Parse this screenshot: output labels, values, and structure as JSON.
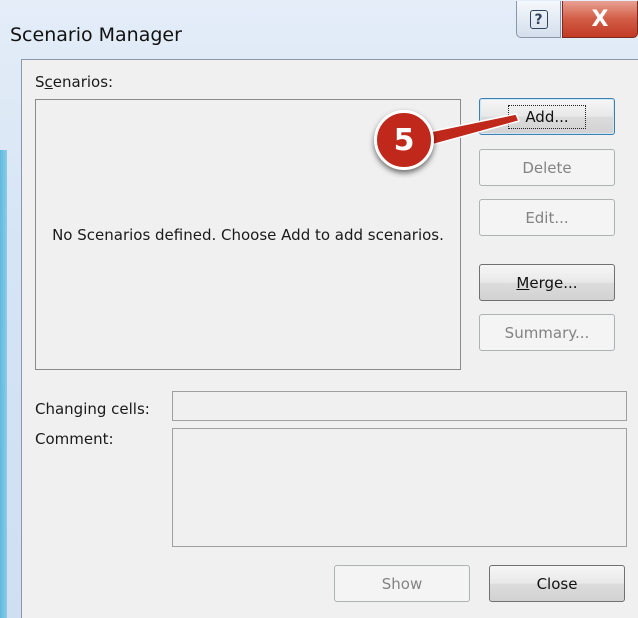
{
  "window": {
    "title": "Scenario Manager",
    "help_label": "?",
    "close_label": "X"
  },
  "scenarios": {
    "label_prefix": "S",
    "label_accel": "c",
    "label_suffix": "enarios:",
    "empty_message": "No Scenarios defined. Choose Add to add scenarios."
  },
  "buttons": {
    "add": "Add...",
    "delete": "Delete",
    "edit": "Edit...",
    "merge_accel": "M",
    "merge_rest": "erge...",
    "summary": "Summary...",
    "show": "Show",
    "close": "Close"
  },
  "fields": {
    "changing_cells_label": "Changing cells:",
    "changing_cells_value": "",
    "comment_label": "Comment:",
    "comment_value": ""
  },
  "annotation": {
    "step_number": "5",
    "color": "#c0281c"
  }
}
